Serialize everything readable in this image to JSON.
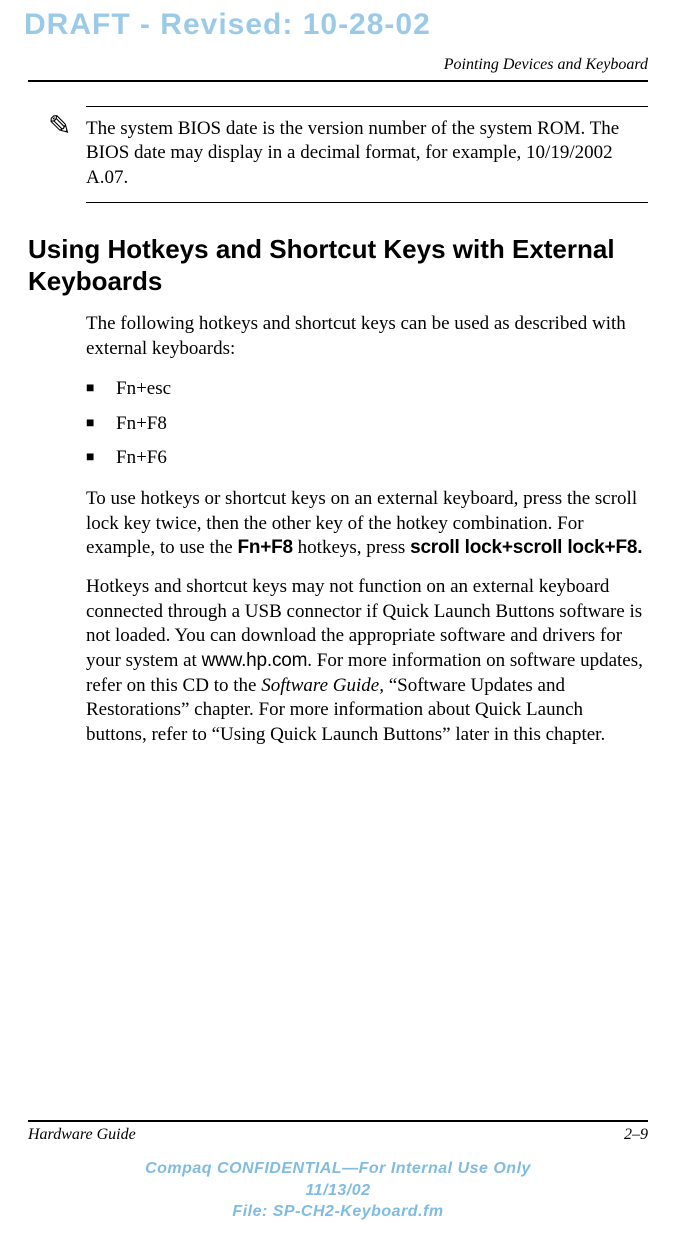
{
  "watermark": "DRAFT - Revised: 10-28-02",
  "header": {
    "running_title": "Pointing Devices and Keyboard"
  },
  "note": {
    "icon": "✎",
    "text": "The system BIOS date is the version number of the system ROM. The BIOS date may display in a decimal format, for example, 10/19/2002 A.07."
  },
  "section": {
    "title": "Using Hotkeys and Shortcut Keys with External Keyboards",
    "intro": "The following hotkeys and shortcut keys can be used as described with external keyboards:",
    "bullets": [
      "Fn+esc",
      "Fn+F8",
      "Fn+F6"
    ],
    "para2_pre": "To use hotkeys or shortcut keys on an external keyboard, press the scroll lock key twice, then the other key of the hotkey combination. For example, to use the ",
    "para2_k1": "Fn+F8",
    "para2_mid": " hotkeys, press ",
    "para2_k2": "scroll lock+scroll lock+F8.",
    "para3_a": "Hotkeys and shortcut keys may not function on an external keyboard connected through a USB connector if Quick Launch Buttons software is not loaded. You can download the appropriate software and drivers for your system at ",
    "para3_url": "www.hp.com",
    "para3_b": ". For more information on software updates, refer on this CD to the ",
    "para3_i": "Software Guide,",
    "para3_c": " “Software Updates and Restorations” chapter. For more information about Quick Launch buttons, refer to “Using Quick Launch Buttons” later in this chapter."
  },
  "footer": {
    "left": "Hardware Guide",
    "right": "2–9",
    "conf_line1": "Compaq CONFIDENTIAL—For Internal Use Only",
    "conf_line2": "11/13/02",
    "conf_line3": "File: SP-CH2-Keyboard.fm"
  }
}
